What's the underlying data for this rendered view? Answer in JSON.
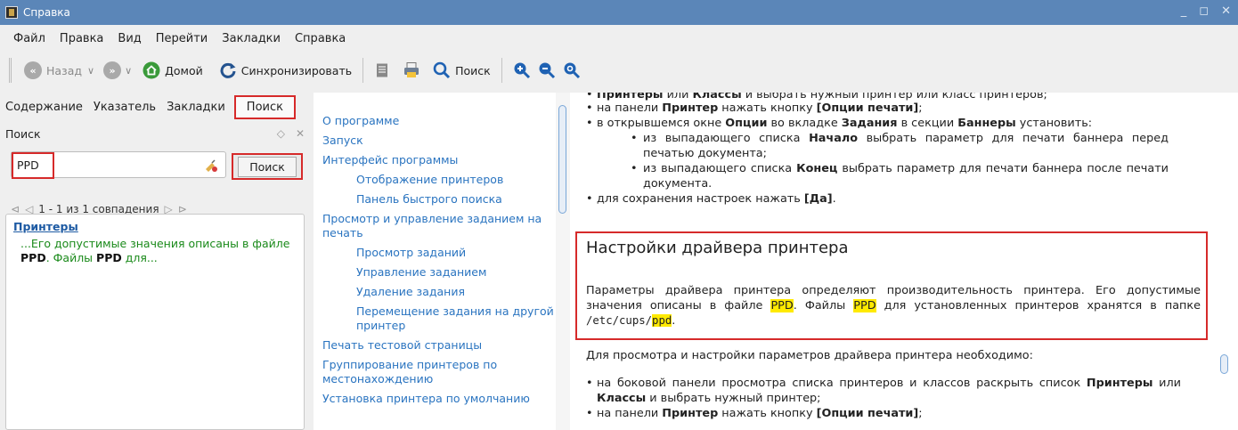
{
  "window": {
    "title": "Справка"
  },
  "menubar": [
    "Файл",
    "Правка",
    "Вид",
    "Перейти",
    "Закладки",
    "Справка"
  ],
  "toolbar": {
    "back": "Назад",
    "home": "Домой",
    "sync": "Синхронизировать",
    "find": "Поиск"
  },
  "left_tabs": [
    "Содержание",
    "Указатель",
    "Закладки",
    "Поиск"
  ],
  "search": {
    "header": "Поиск",
    "query": "PPD",
    "button": "Поиск",
    "matches": "1 - 1 из 1 совпадения",
    "result_title": "Принтеры",
    "result_snippet_pre": "...Его допустимые значения описаны в файле ",
    "result_snippet_b1": "PPD",
    "result_snippet_mid": ". Файлы ",
    "result_snippet_b2": "PPD",
    "result_snippet_post": " для..."
  },
  "toc": [
    {
      "label": "О программе",
      "level": 0
    },
    {
      "label": "Запуск",
      "level": 0
    },
    {
      "label": "Интерфейс программы",
      "level": 0
    },
    {
      "label": "Отображение принтеров",
      "level": 1
    },
    {
      "label": "Панель быстрого поиска",
      "level": 1
    },
    {
      "label": "Просмотр и управление заданием на печать",
      "level": 0
    },
    {
      "label": "Просмотр заданий",
      "level": 1
    },
    {
      "label": "Управление заданием",
      "level": 1
    },
    {
      "label": "Удаление задания",
      "level": 1
    },
    {
      "label": "Перемещение задания на другой принтер",
      "level": 1
    },
    {
      "label": "Печать тестовой страницы",
      "level": 0
    },
    {
      "label": "Группирование принтеров по местонахождению",
      "level": 0
    },
    {
      "label": "Установка принтера по умолчанию",
      "level": 0
    }
  ],
  "content": {
    "top_cut_b1": "Принтеры",
    "top_cut_t1": " или ",
    "top_cut_b2": "Классы",
    "top_cut_t2": " и выбрать нужный принтер или класс принтеров;",
    "li_a_t1": "на панели ",
    "li_a_b1": "Принтер",
    "li_a_t2": " нажать кнопку ",
    "li_a_b2": "[Опции печати]",
    "li_a_t3": ";",
    "li_b_t1": "в открывшемся окне ",
    "li_b_b1": "Опции",
    "li_b_t2": " во вкладке ",
    "li_b_b2": "Задания",
    "li_b_t3": " в секции ",
    "li_b_b3": "Баннеры",
    "li_b_t4": " установить:",
    "sub1_t1": "из выпадающего списка ",
    "sub1_b1": "Начало",
    "sub1_t2": " выбрать параметр для печати баннера перед печатью документа;",
    "sub2_t1": "из выпадающего списка ",
    "sub2_b1": "Конец",
    "sub2_t2": " выбрать параметр для печати баннера после печати документа.",
    "li_c_t1": "для сохранения настроек нажать ",
    "li_c_b1": "[Да]",
    "li_c_t2": ".",
    "heading": "Настройки драйвера принтера",
    "para1_t1": "Параметры драйвера принтера определяют производительность принтера. Его допустимые значения описаны в файле ",
    "para1_h1": "PPD",
    "para1_t2": ". Файлы ",
    "para1_h2": "PPD",
    "para1_t3": " для установленных принтеров хранятся в папке ",
    "para1_code1": "/etc/cups/",
    "para1_code2": "ppd",
    "para1_t4": ".",
    "para2": "Для просмотра и настройки параметров драйвера принтера необходимо:",
    "li_d_t1": "на боковой панели просмотра списка принтеров и классов раскрыть список ",
    "li_d_b1": "Принтеры",
    "li_d_t2": " или ",
    "li_d_b2": "Классы",
    "li_d_t3": " и выбрать нужный принтер;",
    "li_e_t1": "на панели ",
    "li_e_b1": "Принтер",
    "li_e_t2": " нажать кнопку ",
    "li_e_b2": "[Опции печати]",
    "li_e_t3": ";"
  },
  "colors": {
    "titlebar": "#5b86b8",
    "link": "#2a74c0",
    "highlight": "#ffea00",
    "annotation_red": "#d62a2a"
  }
}
